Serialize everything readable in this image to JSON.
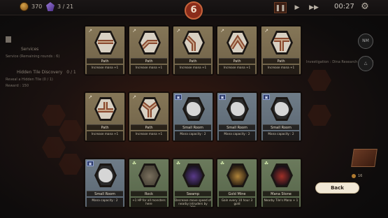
{
  "topbar": {
    "coins": "370",
    "cards_count": "3 / 21",
    "turn": "6",
    "pause_icon": "pause-icon",
    "play_icon": "play-icon",
    "fast_forward_icon": "fast-forward-icon",
    "timer": "00:27",
    "settings_icon": "gear-icon"
  },
  "background": {
    "section_services": "Services",
    "services_line": "Service (Remaining rounds : 6)",
    "section_hidden": "Hidden Tile Discovery",
    "hidden_count": "0 / 1",
    "hidden_line": "Reveal a Hidden Tile (0 / 1)",
    "reward_line": "Reward : 150",
    "research_line": "Investigation : Dina Research Contract",
    "orb_label": "NM"
  },
  "cards": [
    {
      "kind": "road",
      "icon": "road-icon",
      "shape": "straight",
      "name": "Path",
      "desc": "Increase mana +1"
    },
    {
      "kind": "road",
      "icon": "road-icon",
      "shape": "curve",
      "name": "Path",
      "desc": "Increase mana +1"
    },
    {
      "kind": "road",
      "icon": "road-icon",
      "shape": "curve-left",
      "name": "Path",
      "desc": "Increase mana +1"
    },
    {
      "kind": "road",
      "icon": "road-icon",
      "shape": "chevron",
      "name": "Path",
      "desc": "Increase mana +1"
    },
    {
      "kind": "road",
      "icon": "road-icon",
      "shape": "tee",
      "name": "Path",
      "desc": "Increase mana +1"
    },
    {
      "kind": "road",
      "icon": "road-icon",
      "shape": "tee-down",
      "name": "Path",
      "desc": "Increase mana +1"
    },
    {
      "kind": "road",
      "icon": "road-icon",
      "shape": "y-split",
      "name": "Path",
      "desc": "Increase mana +1"
    },
    {
      "kind": "room",
      "icon": "room-icon",
      "shape": "blob",
      "name": "Small Room",
      "desc": "Mana capacity : 2"
    },
    {
      "kind": "room",
      "icon": "room-icon",
      "shape": "blob",
      "name": "Small Room",
      "desc": "Mana capacity : 2"
    },
    {
      "kind": "room",
      "icon": "room-icon",
      "shape": "blob",
      "name": "Small Room",
      "desc": "Mana capacity : 2"
    },
    {
      "kind": "room",
      "icon": "room-icon",
      "shape": "blob",
      "name": "Small Room",
      "desc": "Mana capacity : 2"
    },
    {
      "kind": "feat",
      "icon": "leaf-icon",
      "shape": "rock",
      "name": "Rock",
      "desc": "+1 HP for all monsters here"
    },
    {
      "kind": "feat",
      "icon": "leaf-icon",
      "shape": "swamp",
      "name": "Swamp",
      "desc": "Decrease move speed of nearby intruders by 20%"
    },
    {
      "kind": "feat",
      "icon": "leaf-icon",
      "shape": "goldmine",
      "name": "Gold Mine",
      "desc": "Gain every 10 hour 3 gold"
    },
    {
      "kind": "feat",
      "icon": "leaf-icon",
      "shape": "manastone",
      "name": "Mana Stone",
      "desc": "Nearby Tile's Mana + 1"
    }
  ],
  "back_button": "Back",
  "deck_count": "16"
}
